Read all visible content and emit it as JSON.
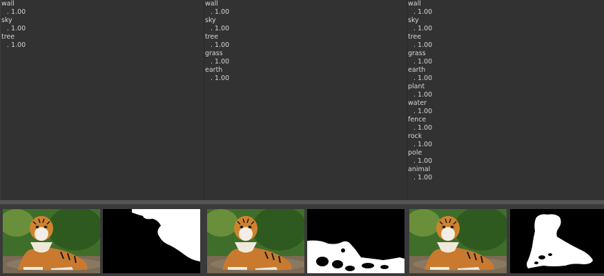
{
  "panels": [
    {
      "labels": [
        {
          "name": "wall",
          "score": ". 1.00"
        },
        {
          "name": "sky",
          "score": ". 1.00"
        },
        {
          "name": "tree",
          "score": ". 1.00"
        }
      ]
    },
    {
      "labels": [
        {
          "name": "wall",
          "score": ". 1.00"
        },
        {
          "name": "sky",
          "score": ". 1.00"
        },
        {
          "name": "tree",
          "score": ". 1.00"
        },
        {
          "name": "grass",
          "score": ". 1.00"
        },
        {
          "name": "earth",
          "score": ". 1.00"
        }
      ]
    },
    {
      "labels": [
        {
          "name": "wall",
          "score": ". 1.00"
        },
        {
          "name": "sky",
          "score": ". 1.00"
        },
        {
          "name": "tree",
          "score": ". 1.00"
        },
        {
          "name": "grass",
          "score": ". 1.00"
        },
        {
          "name": "earth",
          "score": ". 1.00"
        },
        {
          "name": "plant",
          "score": ". 1.00"
        },
        {
          "name": "water",
          "score": ". 1.00"
        },
        {
          "name": "fence",
          "score": ". 1.00"
        },
        {
          "name": "rock",
          "score": ". 1.00"
        },
        {
          "name": "pole",
          "score": ". 1.00"
        },
        {
          "name": "animal",
          "score": ". 1.00"
        }
      ]
    }
  ],
  "colors": {
    "background": "#333333",
    "text": "#d6d6d6",
    "splitter": "#555555",
    "mask_fg": "#ffffff",
    "mask_bg": "#000000"
  }
}
